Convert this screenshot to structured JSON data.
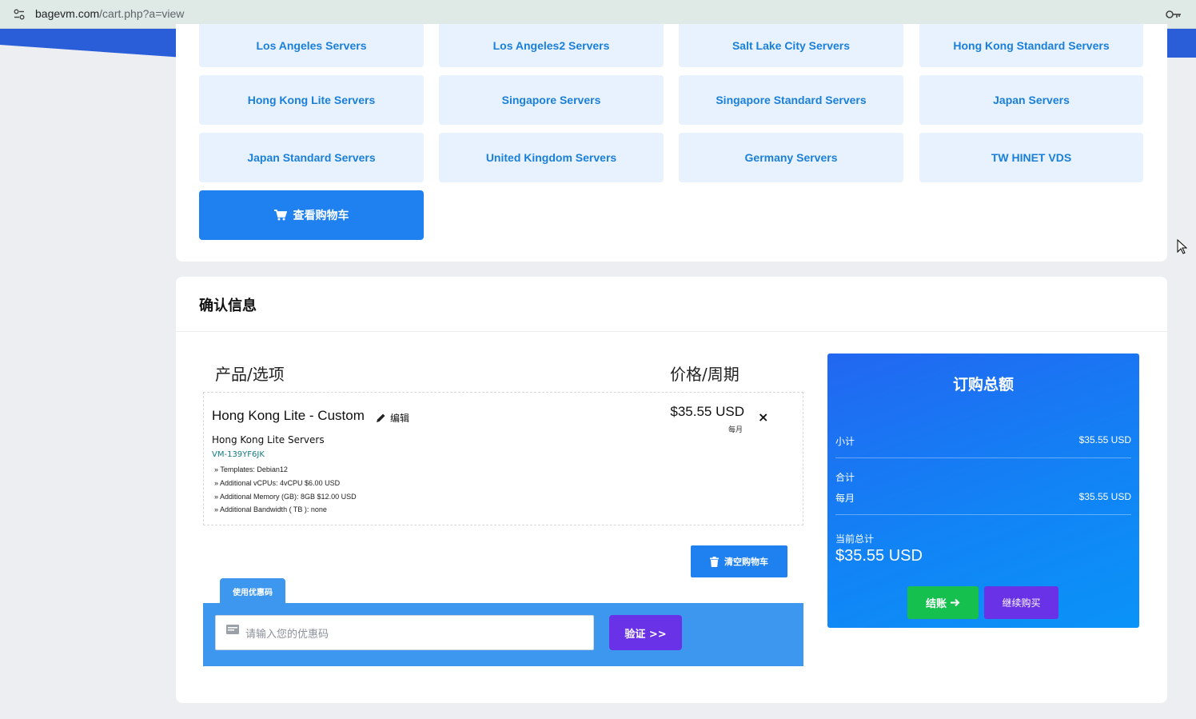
{
  "browser": {
    "url_host": "bagevm.com",
    "url_path": "/cart.php?a=view",
    "site_settings_icon": "tune-icon",
    "password_key_icon": "key-icon"
  },
  "categories": [
    "Los Angeles Servers",
    "Los Angeles2 Servers",
    "Salt Lake City Servers",
    "Hong Kong Standard Servers",
    "Hong Kong Lite Servers",
    "Singapore Servers",
    "Singapore Standard Servers",
    "Japan Servers",
    "Japan Standard Servers",
    "United Kingdom Servers",
    "Germany Servers",
    "TW HINET VDS"
  ],
  "view_cart": {
    "label": "查看购物车",
    "icon": "cart-icon"
  },
  "review": {
    "title": "确认信息",
    "col_product": "产品/选项",
    "col_price": "价格/周期",
    "item": {
      "name": "Hong Kong Lite - Custom",
      "edit_label": "编辑",
      "group": "Hong Kong Lite Servers",
      "domain": "VM-139YF6JK",
      "options": [
        "» Templates: Debian12",
        "» Additional vCPUs: 4vCPU $6.00 USD",
        "» Additional Memory (GB): 8GB $12.00 USD",
        "» Additional Bandwidth ( TB ): none"
      ],
      "price": "$35.55 USD",
      "cycle": "每月",
      "remove": "×"
    },
    "empty_cart_label": "清空购物车"
  },
  "promo": {
    "tab_label": "使用优惠码",
    "placeholder": "请输入您的优惠码",
    "validate_label": "验证 >>"
  },
  "summary": {
    "title": "订购总额",
    "subtotal_label": "小计",
    "subtotal_value": "$35.55 USD",
    "totals_label": "合计",
    "recurring_label": "每月",
    "recurring_value": "$35.55 USD",
    "total_due_label": "当前总计",
    "total_due_value": "$35.55 USD",
    "checkout_label": "结账",
    "continue_label": "继续购买"
  },
  "colors": {
    "accent": "#1f80f0",
    "tile_bg": "#e8f2fe",
    "tile_text": "#1a7fd8",
    "purple": "#6a32e6",
    "green": "#16c04e"
  }
}
